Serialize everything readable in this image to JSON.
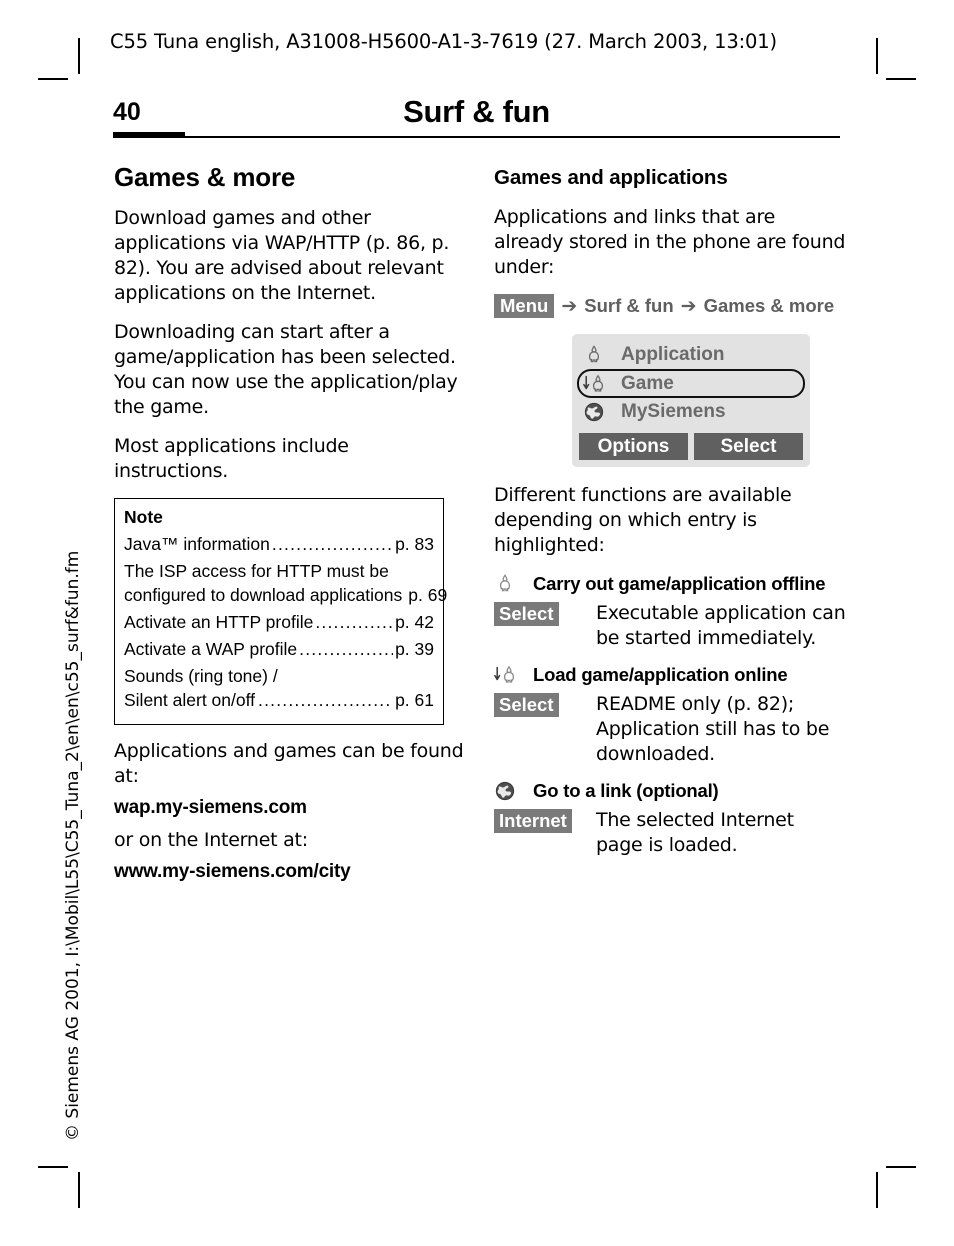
{
  "header": {
    "running_head": "C55 Tuna english, A31008-H5600-A1-3-7619 (27. March 2003, 13:01)"
  },
  "title_block": {
    "page_number": "40",
    "page_title": "Surf & fun"
  },
  "side_caption": {
    "text": "© Siemens AG 2001, I:\\Mobil\\L55\\C55_Tuna_2\\en\\en\\c55_surf&fun.fm"
  },
  "left_column": {
    "section_heading": "Games & more",
    "paragraphs": [
      "Download games and other applications via WAP/HTTP (p. 86, p. 82). You are advised about relevant applications on the Internet.",
      "Downloading can start after a game/application has been selected. You can now use the application/play the game.",
      "Most applications include instructions."
    ],
    "note_box": {
      "title": "Note",
      "rows": [
        {
          "label": "Java™ information",
          "page": "p. 83"
        },
        {
          "label": "Activate an HTTP profile",
          "page": "p. 42"
        },
        {
          "label": "Activate a WAP profile",
          "page": "p. 39"
        }
      ],
      "isp_block": {
        "line1": "The ISP access for HTTP must be",
        "line2": "configured to download applications",
        "page": "p. 69"
      },
      "sounds_block": {
        "line1": "Sounds (ring tone) /",
        "line2": "Silent alert on/off",
        "page": "p. 61"
      }
    },
    "found_at_text": "Applications and games can be found at:",
    "wap_url": "wap.my-siemens.com",
    "or_internet_text": "or on the Internet at:",
    "web_url": "www.my-siemens.com/city"
  },
  "right_column": {
    "sub_heading": "Games and applications",
    "intro_paragraph": "Applications and links that are already stored in the phone are found under:",
    "menu_path": {
      "menu_label": "Menu",
      "arrow": "➔",
      "step1": "Surf & fun",
      "step2": "Games & more"
    },
    "phone_mock": {
      "rows": [
        {
          "icon": "java-duke-icon",
          "label": "Application",
          "selected": false
        },
        {
          "icon": "download-duke-icon",
          "label": "Game",
          "selected": true
        },
        {
          "icon": "globe-icon",
          "label": "MySiemens",
          "selected": false
        }
      ],
      "softkeys": [
        {
          "label": "Options"
        },
        {
          "label": "Select"
        }
      ]
    },
    "functions_intro": "Different functions are available depending on which entry is highlighted:",
    "functions": [
      {
        "icon": "java-duke-icon",
        "title": "Carry out game/application offline",
        "key": "Select",
        "description": "Executable application can be started immediately."
      },
      {
        "icon": "download-duke-icon",
        "title": "Load game/application online",
        "key": "Select",
        "description": "README only (p. 82); Application still has to be downloaded."
      },
      {
        "icon": "globe-icon",
        "title": "Go to a link (optional)",
        "key": "Internet",
        "description": "The selected Internet page is loaded."
      }
    ]
  },
  "colors": {
    "badge_gray": "#7a7a7a",
    "softkey_gray": "#606060",
    "screen_gray": "#e2e2e2",
    "label_gray": "#6a6a6a",
    "menu_path_gray": "#5f5f5f",
    "ink": "#000000"
  }
}
